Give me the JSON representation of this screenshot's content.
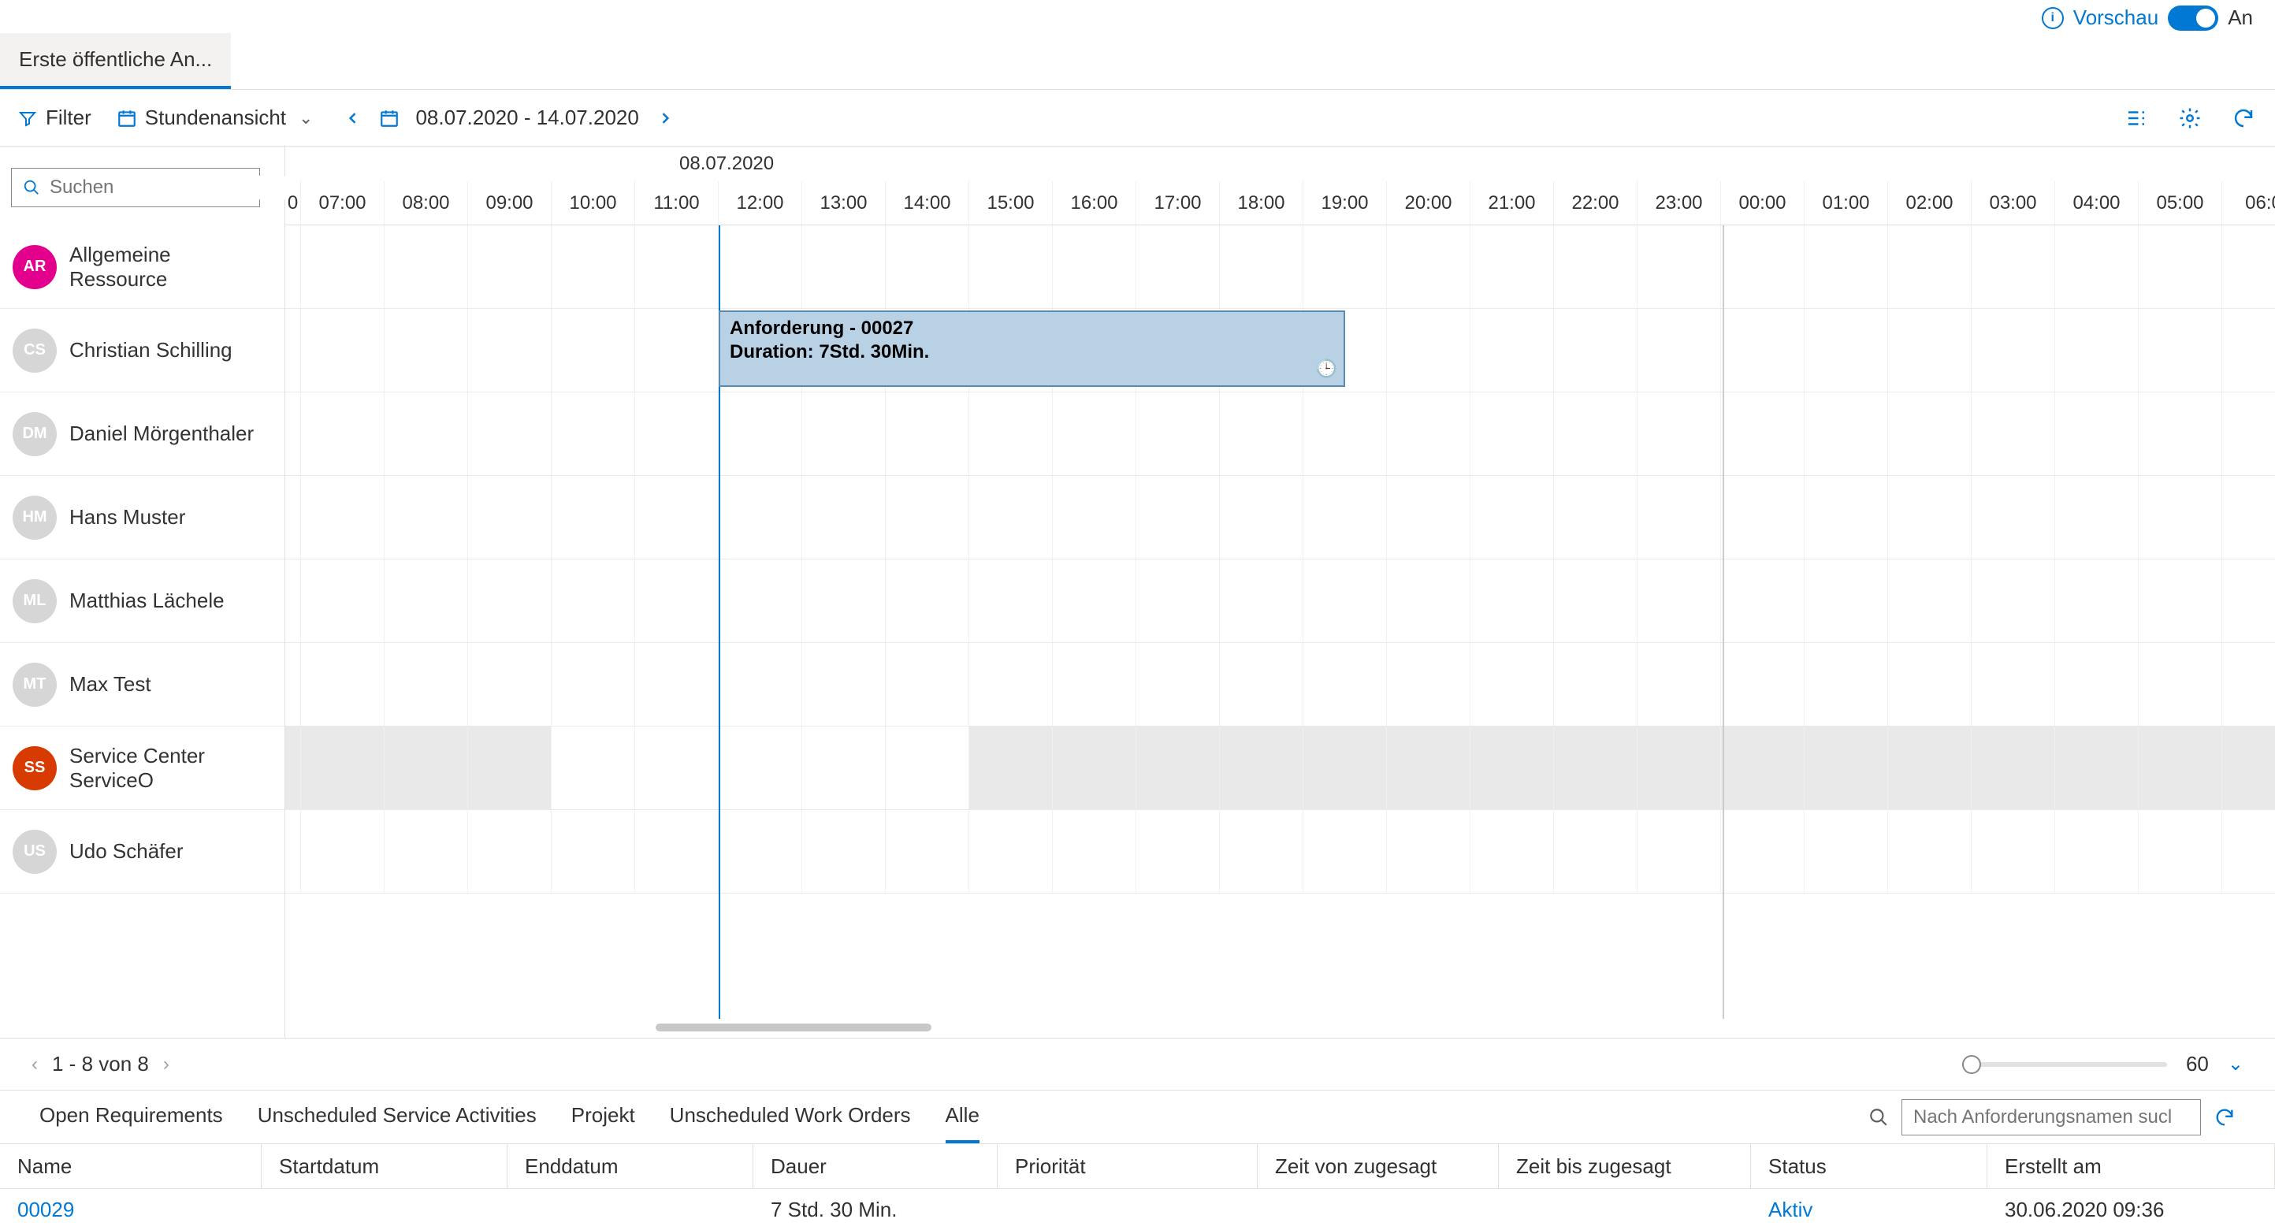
{
  "preview": {
    "label": "Vorschau",
    "on": "An"
  },
  "tab": {
    "label": "Erste öffentliche An..."
  },
  "toolbar": {
    "filter": "Filter",
    "view": "Stundenansicht",
    "date_range": "08.07.2020 - 14.07.2020"
  },
  "search": {
    "placeholder": "Suchen"
  },
  "timeline": {
    "date": "08.07.2020",
    "hours": [
      "0",
      "07:00",
      "08:00",
      "09:00",
      "10:00",
      "11:00",
      "12:00",
      "13:00",
      "14:00",
      "15:00",
      "16:00",
      "17:00",
      "18:00",
      "19:00",
      "20:00",
      "21:00",
      "22:00",
      "23:00",
      "00:00",
      "01:00",
      "02:00",
      "03:00",
      "04:00",
      "05:00",
      "06:0"
    ]
  },
  "resources": [
    {
      "name": "Allgemeine Ressource",
      "initials": "AR",
      "avatar": "pink"
    },
    {
      "name": "Christian Schilling",
      "initials": "CS",
      "avatar": "gray"
    },
    {
      "name": "Daniel Mörgenthaler",
      "initials": "DM",
      "avatar": "gray"
    },
    {
      "name": "Hans Muster",
      "initials": "HM",
      "avatar": "gray"
    },
    {
      "name": "Matthias Lächele",
      "initials": "ML",
      "avatar": "gray"
    },
    {
      "name": "Max Test",
      "initials": "MT",
      "avatar": "gray"
    },
    {
      "name": "Service Center ServiceO",
      "initials": "SS",
      "avatar": "orange"
    },
    {
      "name": "Udo Schäfer",
      "initials": "US",
      "avatar": "gray"
    }
  ],
  "booking": {
    "title": "Anforderung - 00027",
    "duration": "Duration: 7Std. 30Min."
  },
  "pager": {
    "text": "1 - 8 von 8",
    "zoom": "60"
  },
  "bottom_tabs": {
    "t1": "Open Requirements",
    "t2": "Unscheduled Service Activities",
    "t3": "Projekt",
    "t4": "Unscheduled Work Orders",
    "t5": "Alle",
    "search_placeholder": "Nach Anforderungsnamen sucl"
  },
  "grid": {
    "cols": {
      "name": "Name",
      "start": "Startdatum",
      "end": "Enddatum",
      "dur": "Dauer",
      "prio": "Priorität",
      "tvon": "Zeit von zugesagt",
      "tbis": "Zeit bis zugesagt",
      "status": "Status",
      "created": "Erstellt am"
    },
    "row": {
      "name": "00029",
      "start": "",
      "end": "",
      "dur": "7 Std. 30 Min.",
      "prio": "",
      "tvon": "",
      "tbis": "",
      "status": "Aktiv",
      "created": "30.06.2020 09:36"
    }
  }
}
